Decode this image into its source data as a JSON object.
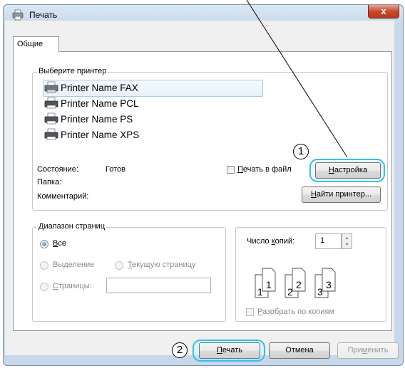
{
  "window": {
    "title": "Печать",
    "close_label": "x"
  },
  "tabs": [
    {
      "label": "Общие"
    }
  ],
  "printer_group": {
    "label": "Выберите принтер",
    "printers": [
      {
        "name": "Printer Name FAX",
        "selected": true
      },
      {
        "name": "Printer Name PCL",
        "selected": false
      },
      {
        "name": "Printer Name PS",
        "selected": false
      },
      {
        "name": "Printer Name XPS",
        "selected": false
      }
    ],
    "status_label": "Состояние:",
    "status_value": "Готов",
    "folder_label": "Папка:",
    "comment_label": "Комментарий:",
    "print_to_file_pre": "",
    "print_to_file_u": "П",
    "print_to_file_post": "ечать в файл",
    "settings_button_pre": "",
    "settings_button_u": "Н",
    "settings_button_post": "астройка",
    "find_printer_button_pre": "",
    "find_printer_button_u": "Н",
    "find_printer_button_post": "айти принтер..."
  },
  "range_group": {
    "label": "Диапазон страниц",
    "all_u": "В",
    "all_post": "се",
    "selection_pre": "Вы",
    "selection_u": "д",
    "selection_post": "еление",
    "current_pre": "",
    "current_u": "Т",
    "current_post": "екущую страницу",
    "pages_u": "С",
    "pages_post": "траницы:",
    "pages_value": ""
  },
  "copies_group": {
    "copies_label_pre": "Число ",
    "copies_label_u": "к",
    "copies_label_post": "опий:",
    "copies_value": "1",
    "collate_u": "Р",
    "collate_post": "азобрать по копиям",
    "collate_sheets": [
      "1",
      "1",
      "2",
      "2",
      "3",
      "3"
    ]
  },
  "buttons": {
    "print_u": "П",
    "print_post": "ечать",
    "cancel": "Отмена",
    "apply_pre": "При",
    "apply_u": "м",
    "apply_post": "енить"
  },
  "callouts": [
    "1",
    "2"
  ],
  "colors": {
    "highlight": "#35c3df",
    "frame": "#c7d8ea",
    "tabpanel": "#ffffff"
  }
}
